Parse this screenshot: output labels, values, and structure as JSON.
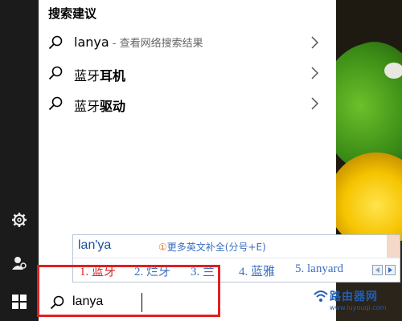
{
  "search_panel": {
    "section_title": "搜索建议",
    "suggestions": [
      {
        "main": "lanya",
        "sub": " - 查看网络搜索结果"
      },
      {
        "prefix": "蓝牙",
        "bold": "耳机"
      },
      {
        "prefix": "蓝牙",
        "bold": "驱动"
      }
    ]
  },
  "ime": {
    "composition": "lan'ya",
    "hint_badge": "①",
    "hint": "更多英文补全(分号+E)",
    "candidates": [
      "1. 蓝牙",
      "2. 烂牙",
      "3. 兰",
      "4. 蓝雅",
      "5. lanyard"
    ]
  },
  "search_box": {
    "query": "lanya"
  },
  "watermark": {
    "name": "路由器网",
    "url": "www.luyouqi.com"
  },
  "colors": {
    "highlight": "#e02020",
    "ime_first": "#d62626",
    "ime_other": "#3a6fc2"
  },
  "icons": {
    "rail": [
      "gear-icon",
      "person-icon",
      "windows-icon"
    ],
    "suggestion": "search-icon",
    "chevron": "chevron-right-icon"
  }
}
